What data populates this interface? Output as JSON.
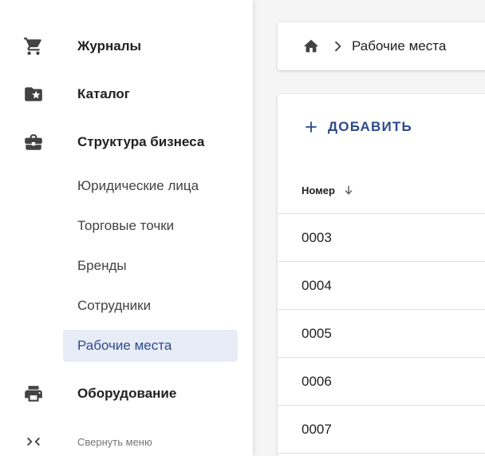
{
  "sidebar": {
    "items": [
      {
        "label": "Журналы",
        "icon": "cart-icon"
      },
      {
        "label": "Каталог",
        "icon": "folder-star-icon"
      },
      {
        "label": "Структура бизнеса",
        "icon": "briefcase-icon"
      }
    ],
    "subitems": [
      {
        "label": "Юридические лица"
      },
      {
        "label": "Торговые точки"
      },
      {
        "label": "Бренды"
      },
      {
        "label": "Сотрудники"
      },
      {
        "label": "Рабочие места",
        "active": true
      }
    ],
    "equipment": {
      "label": "Оборудование",
      "icon": "printer-icon"
    },
    "collapse": {
      "label": "Свернуть меню",
      "icon": "collapse-arrows-icon"
    }
  },
  "breadcrumb": {
    "home_icon": "home-icon",
    "current": "Рабочие места"
  },
  "main": {
    "add_label": "ДОБАВИТЬ",
    "table": {
      "column": "Номер",
      "sort": "descending-arrow",
      "rows": [
        "0003",
        "0004",
        "0005",
        "0006",
        "0007"
      ]
    }
  },
  "colors": {
    "accent": "#2c4a8c",
    "active_bg": "#e8ecf6",
    "icon": "#424242"
  }
}
